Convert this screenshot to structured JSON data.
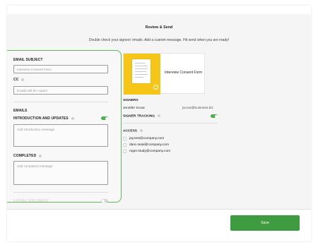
{
  "header": {
    "title": "Review & Send",
    "subtitle": "Double check your signers' emails. Add a custom message. Hit send when you are ready!"
  },
  "form": {
    "email_subject_label": "EMAIL SUBJECT",
    "email_subject_placeholder": "Interview Consent Form",
    "cc_label": "CC",
    "cc_placeholder": "Emails will be copied",
    "emails_label": "EMAILS",
    "intro_label": "INTRODUCTION AND UPDATES",
    "intro_toggle_on": true,
    "intro_placeholder": "Add introduction message",
    "completed_label": "COMPLETED",
    "completed_placeholder": "Add completed message",
    "expire_label": "EXPIRE DOCUMENT",
    "expire_toggle_on": false
  },
  "document": {
    "name": "Interview Consent Form",
    "thumb_color": "#f5c518"
  },
  "signers": {
    "label": "SIGNERS",
    "items": [
      {
        "name": "Jennifer Scout",
        "email": "jscout@business.biz"
      }
    ],
    "tracking_label": "SIGNER TRACKING",
    "tracking_on": true
  },
  "access": {
    "label": "ACCESS",
    "emails": [
      "jay.test@company.com",
      "dani.casal@company.com",
      "roger.study@company.com"
    ]
  },
  "footer": {
    "save_label": "Save"
  },
  "colors": {
    "accent": "#3f9b3f",
    "highlight_border": "#5cb85c"
  }
}
